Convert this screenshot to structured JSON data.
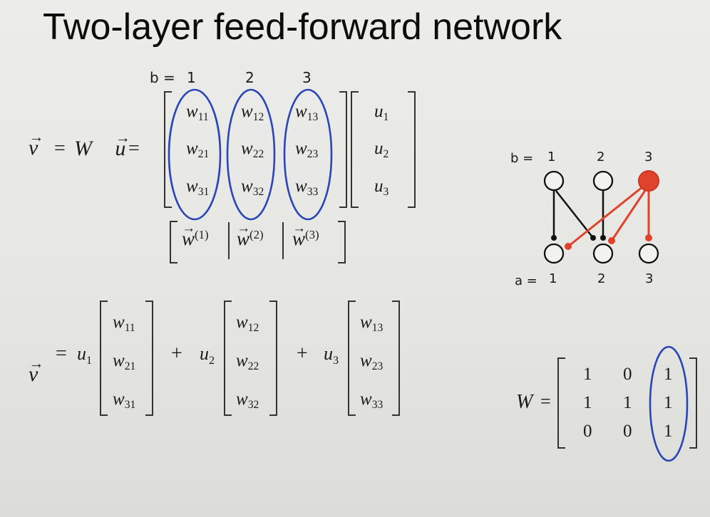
{
  "title": "Two-layer feed-forward network",
  "eq1": {
    "b_label": "b =",
    "b_idx": [
      "1",
      "2",
      "3"
    ],
    "lhs_v": "v",
    "eq": "=",
    "W": "W",
    "u_vec": "u",
    "eq2": "=",
    "w": "w",
    "entries": [
      [
        "11",
        "12",
        "13"
      ],
      [
        "21",
        "22",
        "23"
      ],
      [
        "31",
        "32",
        "33"
      ]
    ],
    "u": "u",
    "u_idx": [
      "1",
      "2",
      "3"
    ],
    "cols": [
      "(1)",
      "(2)",
      "(3)"
    ]
  },
  "eq2": {
    "lhs_v": "v",
    "eq": "=",
    "coef": "u",
    "coef_idx": [
      "1",
      "2",
      "3"
    ],
    "plus": "+",
    "w": "w",
    "cols": [
      [
        "11",
        "21",
        "31"
      ],
      [
        "12",
        "22",
        "32"
      ],
      [
        "13",
        "23",
        "33"
      ]
    ]
  },
  "network": {
    "b_label": "b =",
    "a_label": "a =",
    "top": [
      "1",
      "2",
      "3"
    ],
    "bottom": [
      "1",
      "2",
      "3"
    ],
    "highlight_color": "#e0432b"
  },
  "example": {
    "W": "W",
    "eq": "=",
    "rows": [
      [
        "1",
        "0",
        "1"
      ],
      [
        "1",
        "1",
        "1"
      ],
      [
        "0",
        "0",
        "1"
      ]
    ]
  },
  "colors": {
    "ellipse": "#2a45b8",
    "red": "#e0432b"
  }
}
